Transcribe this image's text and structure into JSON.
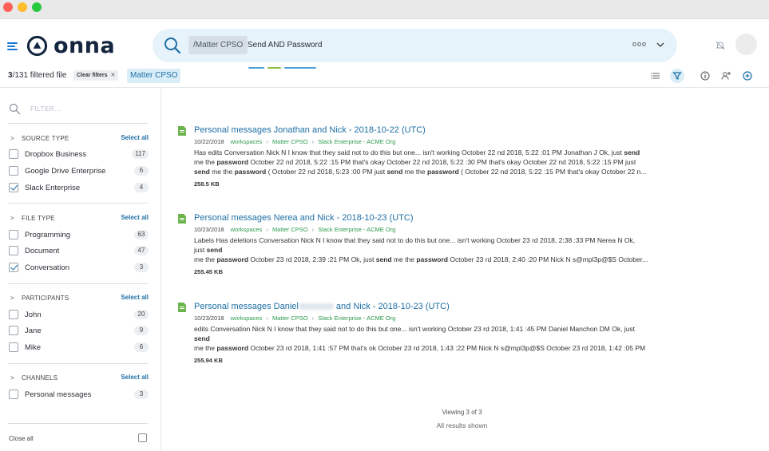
{
  "app": {
    "logo_text": "onna"
  },
  "search": {
    "matter_chip": "/Matter CPSO",
    "query": "Send AND Password",
    "more_label": "ooo"
  },
  "filterbar": {
    "count_bold": "3",
    "count_rest": "/131 filtered file",
    "clear_filters": "Clear filters",
    "matter_tag": "Matter CPSO"
  },
  "sidebar": {
    "filter_placeholder": "FILTER...",
    "sections": [
      {
        "title": "SOURCE TYPE",
        "select_all": "Select all",
        "items": [
          {
            "label": "Dropbox Business",
            "count": "117",
            "checked": false
          },
          {
            "label": "Google Drive Enterprise",
            "count": "6",
            "checked": false
          },
          {
            "label": "Slack Enterprise",
            "count": "4",
            "checked": true
          }
        ]
      },
      {
        "title": "FILE TYPE",
        "select_all": "Select all",
        "items": [
          {
            "label": "Programming",
            "count": "63",
            "checked": false
          },
          {
            "label": "Document",
            "count": "47",
            "checked": false
          },
          {
            "label": "Conversation",
            "count": "3",
            "checked": true
          }
        ]
      },
      {
        "title": "PARTICIPANTS",
        "select_all": "Select all",
        "items": [
          {
            "label": "John",
            "count": "20",
            "checked": false
          },
          {
            "label": "Jane",
            "count": "9",
            "checked": false
          },
          {
            "label": "Mike",
            "count": "6",
            "checked": false
          }
        ]
      },
      {
        "title": "CHANNELS",
        "select_all": "Select all",
        "items": [
          {
            "label": "Personal messages",
            "count": "3",
            "checked": false
          }
        ]
      }
    ],
    "close_all": "Close all"
  },
  "results": [
    {
      "title": "Personal messages Jonathan and Nick - 2018-10-22 (UTC)",
      "date": "10/22/2018",
      "crumbs": [
        "workspaces",
        "Matter CPSO",
        "Slack Enterprise - ACME Org"
      ],
      "snippet": [
        [
          {
            "t": "Has edits Conversation Nick N I know that they said not to do this but one... isn't working October 22 nd 2018, 5:22 :01 PM Jonathan J Ok, just "
          },
          {
            "t": "send",
            "b": true
          }
        ],
        [
          {
            "t": "me the "
          },
          {
            "t": "password",
            "b": true
          },
          {
            "t": " October 22 nd 2018, 5:22 :15 PM that's okay October 22 nd 2018, 5:22 :30 PM that's okay October 22 nd 2018, 5:22 :15 PM just"
          }
        ],
        [
          {
            "t": "send",
            "b": true
          },
          {
            "t": " me the "
          },
          {
            "t": "password",
            "b": true
          },
          {
            "t": " ( October 22 nd 2018, 5:23 :00 PM just "
          },
          {
            "t": "send",
            "b": true
          },
          {
            "t": " me the "
          },
          {
            "t": "password",
            "b": true
          },
          {
            "t": " ( October 22 nd 2018, 5:22 :15 PM that's okay October 22 n..."
          }
        ]
      ],
      "size": "258.5 KB"
    },
    {
      "title": "Personal messages Nerea and Nick - 2018-10-23 (UTC)",
      "date": "10/23/2018",
      "crumbs": [
        "workspaces",
        "Matter CPSO",
        "Slack Enterprise - ACME Org"
      ],
      "snippet": [
        [
          {
            "t": "Labels Has deletions Conversation Nick N I know that they said not to do this but one... isn't working October 23 rd 2018, 2:38 :33 PM Nerea N Ok,"
          }
        ],
        [
          {
            "t": "just "
          },
          {
            "t": "send",
            "b": true
          }
        ],
        [
          {
            "t": "me the "
          },
          {
            "t": "password",
            "b": true
          },
          {
            "t": " October 23 rd 2018, 2:39 :21 PM Ok, just "
          },
          {
            "t": "send",
            "b": true
          },
          {
            "t": " me the "
          },
          {
            "t": "password",
            "b": true
          },
          {
            "t": " October 23 rd 2018, 2:40 :20 PM Nick N s@mpl3p@$S October..."
          }
        ]
      ],
      "size": "255.45 KB"
    },
    {
      "title_prefix": "Personal messages Daniel",
      "title_suffix": " and Nick - 2018-10-23 (UTC)",
      "date": "10/23/2018",
      "crumbs": [
        "workspaces",
        "Matter CPSO",
        "Slack Enterprise - ACME Org"
      ],
      "snippet": [
        [
          {
            "t": "edits Conversation Nick N I know that they said not to do this but one... isn't working October 23 rd 2018, 1:41 :45 PM Daniel Manchon DM Ok, just"
          }
        ],
        [
          {
            "t": "send",
            "b": true
          }
        ],
        [
          {
            "t": "me the "
          },
          {
            "t": "password",
            "b": true
          },
          {
            "t": " October 23 rd 2018, 1:41 :57 PM that's ok October 23 rd 2018, 1:43 :22 PM Nick N s@mpl3p@$S October 23 rd 2018, 1:42 :05 PM"
          }
        ]
      ],
      "size": "255.94 KB"
    }
  ],
  "footer": {
    "viewing": "Viewing 3 of 3",
    "all_shown": "All results shown"
  },
  "colors": {
    "accent": "#1d6fa5",
    "crumb": "#2e9a4c",
    "search_bg": "#e7f3fb"
  },
  "icons": [
    "hamburger-icon",
    "search-icon",
    "chevron-down-icon",
    "bell-off-icon",
    "list-view-icon",
    "filter-icon",
    "info-icon",
    "add-user-icon",
    "add-circle-icon",
    "document-icon",
    "settings-icon"
  ]
}
